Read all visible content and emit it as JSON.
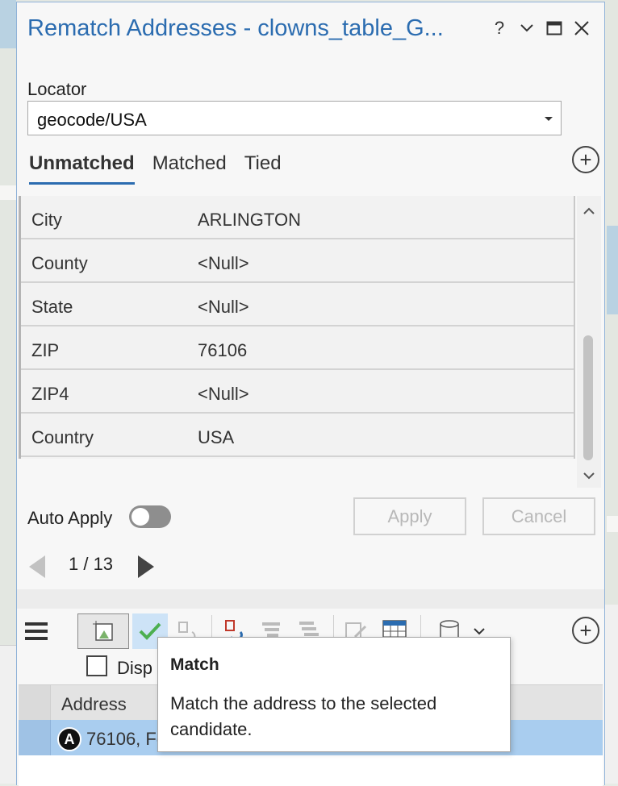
{
  "window": {
    "title": "Rematch Addresses - clowns_table_G...",
    "help_glyph": "?",
    "menu_glyph": "⌄",
    "close_glyph": "✕"
  },
  "locator": {
    "label": "Locator",
    "value": "geocode/USA"
  },
  "tabs": [
    {
      "label": "Unmatched",
      "active": true
    },
    {
      "label": "Matched",
      "active": false
    },
    {
      "label": "Tied",
      "active": false
    }
  ],
  "fields": [
    {
      "name": "City",
      "value": "ARLINGTON"
    },
    {
      "name": "County",
      "value": "<Null>"
    },
    {
      "name": "State",
      "value": "<Null>"
    },
    {
      "name": "ZIP",
      "value": "76106"
    },
    {
      "name": "ZIP4",
      "value": "<Null>"
    },
    {
      "name": "Country",
      "value": "USA"
    }
  ],
  "auto_apply": {
    "label": "Auto Apply",
    "on": false
  },
  "buttons": {
    "apply": "Apply",
    "cancel": "Cancel"
  },
  "pager": {
    "text": "1 / 13"
  },
  "display_checkbox": {
    "label": "Disp",
    "checked": false
  },
  "candidates": {
    "column_header": "Address",
    "rows": [
      {
        "badge": "A",
        "address": "76106, Fo"
      }
    ]
  },
  "tooltip": {
    "title": "Match",
    "body": "Match the address to the selected candidate."
  },
  "colors": {
    "accent": "#2b6cb0",
    "selected_row": "#a9cdef",
    "match_check": "#4caf50"
  }
}
